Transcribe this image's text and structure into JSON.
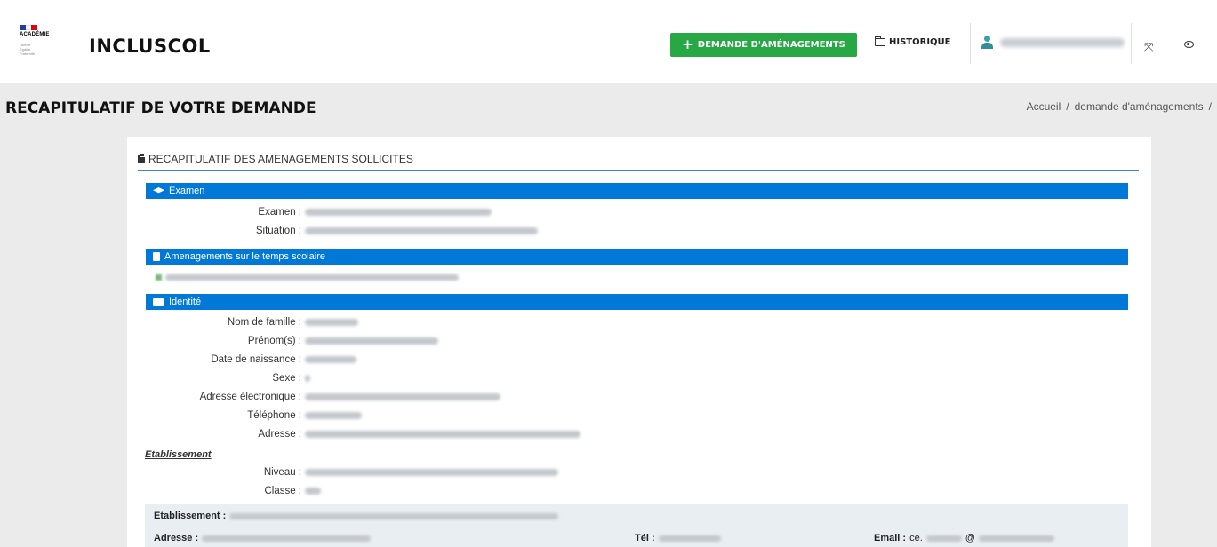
{
  "header": {
    "logo_word": "ACADÉMIE",
    "logo_motto": [
      "Liberté",
      "Égalité",
      "Fraternité"
    ],
    "app_title": "INCLUSCOL",
    "new_request_label": "DEMANDE D'AMÉNAGEMENTS",
    "history_label": "HISTORIQUE",
    "user_name": "",
    "icons": [
      "plus-icon",
      "folder-icon",
      "user-icon",
      "expand-icon",
      "eye-icon"
    ]
  },
  "page": {
    "title": "RECAPITULATIF DE VOTRE DEMANDE",
    "breadcrumb": [
      "Accueil",
      "/",
      "demande d'aménagements",
      "/"
    ]
  },
  "card": {
    "title": "RECAPITULATIF DES AMENAGEMENTS SOLLICITES",
    "sections": {
      "examen": "Examen",
      "temps": "Amenagements sur le temps scolaire",
      "identite": "Identité"
    },
    "examen_fields": [
      {
        "label": "Examen :",
        "value": ""
      },
      {
        "label": "Situation :",
        "value": ""
      }
    ],
    "identite_fields": [
      {
        "label": "Nom de famille :",
        "value": ""
      },
      {
        "label": "Prénom(s) :",
        "value": ""
      },
      {
        "label": "Date de naissance :",
        "value": ""
      },
      {
        "label": "Sexe :",
        "value": ""
      },
      {
        "label": "Adresse électronique :",
        "value": ""
      },
      {
        "label": "Téléphone :",
        "value": ""
      },
      {
        "label": "Adresse :",
        "value": ""
      }
    ],
    "etablissement_label": "Etablissement",
    "etablissement_fields": [
      {
        "label": "Niveau :",
        "value": ""
      },
      {
        "label": "Classe :",
        "value": ""
      }
    ],
    "etab_box": {
      "etab_label": "Etablissement :",
      "adresse_label": "Adresse :",
      "tel_label": "Tél :",
      "email_label": "Email :",
      "email_prefix": "ce.",
      "email_at": "@"
    }
  },
  "colors": {
    "accent_green": "#28a745",
    "section_blue": "#0078d7",
    "page_bg": "#ebebeb"
  }
}
